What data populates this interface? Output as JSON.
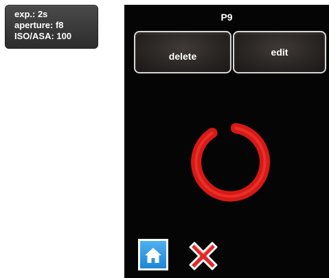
{
  "exposure": {
    "exp": "exp.: 2s",
    "aperture": "aperture: f8",
    "iso": "ISO/ASA: 100"
  },
  "screen": {
    "title": "P9",
    "delete_label": "delete",
    "edit_label": "edit"
  },
  "icons": {
    "spinner": "loading-spinner-icon",
    "home": "home-icon",
    "close": "close-icon"
  },
  "colors": {
    "screen_background": "#050505",
    "spinner": "#e0211c",
    "home_button": "#2a92e0",
    "close_icon": "#e02a2a"
  }
}
